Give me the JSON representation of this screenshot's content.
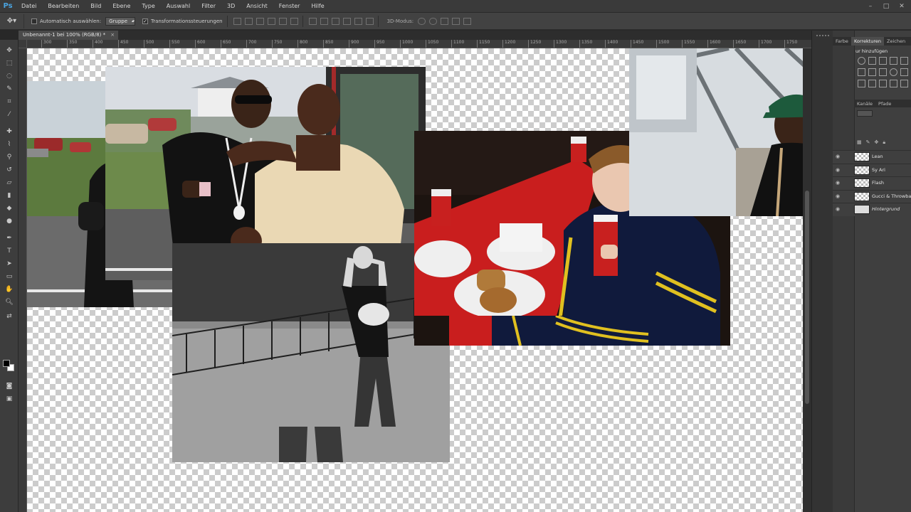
{
  "menubar": {
    "logo": "Ps",
    "items": [
      "Datei",
      "Bearbeiten",
      "Bild",
      "Ebene",
      "Type",
      "Auswahl",
      "Filter",
      "3D",
      "Ansicht",
      "Fenster",
      "Hilfe"
    ]
  },
  "options": {
    "auto_select_label": "Automatisch auswählen:",
    "auto_select_value": "Gruppe",
    "transform_label": "Transformationssteuerungen",
    "transform_checked": "✓",
    "mode3d_label": "3D-Modus:"
  },
  "document": {
    "tab_label": "Unbenannt-1 bei 100% (RGB/8) *",
    "close": "×"
  },
  "ruler_top": [
    "300",
    "350",
    "400",
    "450",
    "500",
    "550",
    "600",
    "650",
    "700",
    "750",
    "800",
    "850",
    "900",
    "950",
    "1000",
    "1050",
    "1100",
    "1150",
    "1200",
    "1250",
    "1300",
    "1350",
    "1400",
    "1450",
    "1500",
    "1550",
    "1600",
    "1650",
    "1700",
    "1750"
  ],
  "panels": {
    "top_tabs": [
      "Farbe",
      "Korrekturen",
      "Zeichen"
    ],
    "active_top_tab": "Korrekturen",
    "adjust_header": "ur hinzufügen",
    "lower_tabs": [
      "Kanäle",
      "Pfade"
    ],
    "layers": [
      {
        "name": "Lean",
        "italic": false
      },
      {
        "name": "Sy Ari",
        "italic": false
      },
      {
        "name": "Flash",
        "italic": false
      },
      {
        "name": "Gucci & Throwba",
        "italic": false
      },
      {
        "name": "Hintergrund",
        "italic": true
      }
    ]
  },
  "colors": {
    "accent": "#4aa3df",
    "chrome": "#3a3a3a",
    "workspace": "#282828"
  }
}
